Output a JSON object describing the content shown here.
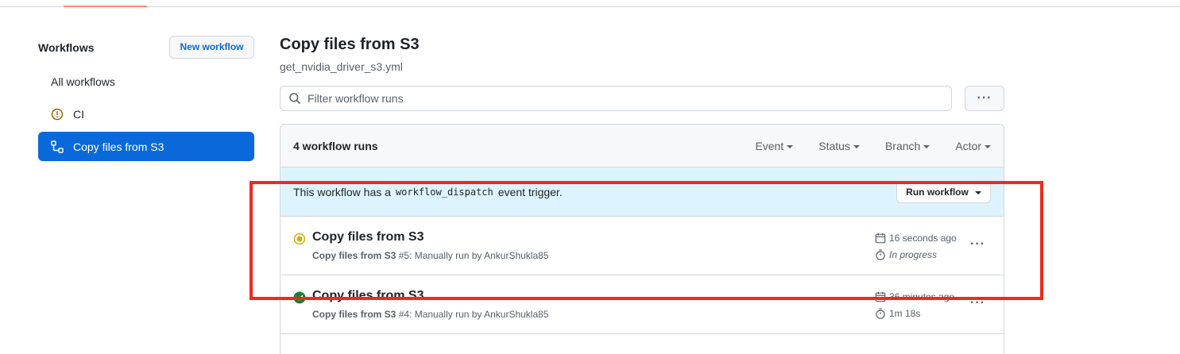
{
  "sidebar": {
    "title": "Workflows",
    "new_workflow_label": "New workflow",
    "items": [
      {
        "label": "All workflows"
      },
      {
        "label": "CI"
      },
      {
        "label": "Copy files from S3"
      }
    ]
  },
  "main": {
    "title": "Copy files from S3",
    "subtitle": "get_nvidia_driver_s3.yml",
    "filter_placeholder": "Filter workflow runs",
    "more_label": "···"
  },
  "runs": {
    "count_label": "4 workflow runs",
    "filters": [
      "Event",
      "Status",
      "Branch",
      "Actor"
    ],
    "dispatch": {
      "text_before": "This workflow has a",
      "code": "workflow_dispatch",
      "text_after": "event trigger.",
      "button_label": "Run workflow"
    },
    "items": [
      {
        "title": "Copy files from S3",
        "workflow": "Copy files from S3",
        "detail": " #5: Manually run by AnkurShukla85",
        "time": "16 seconds ago",
        "duration": "In progress",
        "status": "in-progress"
      },
      {
        "title": "Copy files from S3",
        "workflow": "Copy files from S3",
        "detail": " #4: Manually run by AnkurShukla85",
        "time": "36 minutes ago",
        "duration": "1m 18s",
        "status": "success"
      }
    ],
    "row_more_label": "···"
  },
  "colors": {
    "accent": "#0969da",
    "highlight": "#ee2a1a",
    "in_progress": "#dbab0a",
    "success": "#1a7f37",
    "warning": "#9a6700"
  }
}
